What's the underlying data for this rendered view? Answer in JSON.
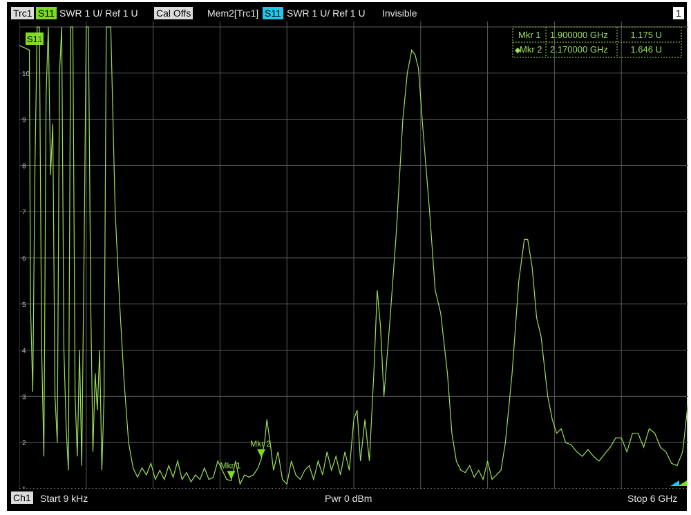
{
  "header": {
    "trace_label": "Trc1",
    "trace_param": "S11",
    "trace_format": "SWR  1 U/  Ref 1 U",
    "cal_status": "Cal Offs",
    "mem_label": "Mem2[Trc1]",
    "mem_param": "S11",
    "mem_format": "SWR  1 U/  Ref 1 U",
    "mem_status": "Invisible",
    "window_number": "1"
  },
  "markers_table": [
    {
      "name": "Mkr 1",
      "freq": "1.900000 GHz",
      "value": "1.175 U",
      "active": false
    },
    {
      "name": "Mkr 2",
      "freq": "2.170000 GHz",
      "value": "1.646 U",
      "active": true
    }
  ],
  "footer": {
    "channel": "Ch1",
    "start": "Start  9 kHz",
    "power": "Pwr  0 dBm",
    "stop": "Stop  6 GHz"
  },
  "colors": {
    "trace": "#9be05a",
    "trace_badge": "#7ddc1f",
    "mem_badge": "#22c8e8",
    "grid": "#5a5a5a",
    "background": "#000000"
  },
  "chart_data": {
    "type": "line",
    "trace_tag": "S11",
    "xlim": [
      9e-06,
      6.0
    ],
    "ylim": [
      1,
      11
    ],
    "yticks": [
      "10",
      "9",
      "8",
      "7",
      "6",
      "5",
      "4",
      "3",
      "2",
      "1"
    ],
    "grid": true,
    "markers": [
      {
        "name": "Mkr 1",
        "label": "Mkr 1",
        "x": 1.9,
        "y": 1.175
      },
      {
        "name": "Mkr 2",
        "label": "Mkr 2",
        "x": 2.17,
        "y": 1.646
      }
    ],
    "series": [
      {
        "points": [
          [
            0.0,
            10.6
          ],
          [
            0.09,
            10.5
          ],
          [
            0.1,
            5.0
          ],
          [
            0.12,
            3.1
          ],
          [
            0.14,
            8.0
          ],
          [
            0.16,
            11.0
          ],
          [
            0.18,
            11.0
          ],
          [
            0.2,
            4.0
          ],
          [
            0.22,
            1.7
          ],
          [
            0.24,
            9.5
          ],
          [
            0.26,
            11.0
          ],
          [
            0.28,
            7.8
          ],
          [
            0.3,
            8.9
          ],
          [
            0.32,
            3.0
          ],
          [
            0.34,
            2.0
          ],
          [
            0.36,
            10.0
          ],
          [
            0.38,
            11.0
          ],
          [
            0.4,
            4.0
          ],
          [
            0.42,
            2.3
          ],
          [
            0.44,
            1.4
          ],
          [
            0.46,
            11.0
          ],
          [
            0.48,
            11.0
          ],
          [
            0.5,
            3.0
          ],
          [
            0.52,
            1.7
          ],
          [
            0.54,
            4.0
          ],
          [
            0.56,
            1.5
          ],
          [
            0.58,
            6.0
          ],
          [
            0.6,
            11.0
          ],
          [
            0.62,
            11.0
          ],
          [
            0.64,
            5.0
          ],
          [
            0.66,
            1.8
          ],
          [
            0.68,
            3.5
          ],
          [
            0.7,
            2.7
          ],
          [
            0.72,
            4.0
          ],
          [
            0.74,
            1.4
          ],
          [
            0.76,
            3.0
          ],
          [
            0.78,
            11.0
          ],
          [
            0.8,
            11.0
          ],
          [
            0.82,
            11.0
          ],
          [
            0.84,
            9.0
          ],
          [
            0.86,
            7.0
          ],
          [
            0.9,
            5.0
          ],
          [
            0.94,
            3.3
          ],
          [
            0.98,
            2.0
          ],
          [
            1.02,
            1.45
          ],
          [
            1.06,
            1.25
          ],
          [
            1.1,
            1.45
          ],
          [
            1.14,
            1.3
          ],
          [
            1.18,
            1.55
          ],
          [
            1.22,
            1.2
          ],
          [
            1.26,
            1.4
          ],
          [
            1.3,
            1.2
          ],
          [
            1.34,
            1.5
          ],
          [
            1.38,
            1.25
          ],
          [
            1.42,
            1.6
          ],
          [
            1.46,
            1.2
          ],
          [
            1.5,
            1.35
          ],
          [
            1.54,
            1.15
          ],
          [
            1.58,
            1.3
          ],
          [
            1.62,
            1.2
          ],
          [
            1.66,
            1.45
          ],
          [
            1.7,
            1.2
          ],
          [
            1.74,
            1.25
          ],
          [
            1.78,
            1.6
          ],
          [
            1.82,
            1.4
          ],
          [
            1.86,
            1.2
          ],
          [
            1.9,
            1.175
          ],
          [
            1.94,
            1.6
          ],
          [
            1.98,
            1.1
          ],
          [
            2.02,
            1.3
          ],
          [
            2.06,
            1.25
          ],
          [
            2.1,
            1.3
          ],
          [
            2.14,
            1.45
          ],
          [
            2.17,
            1.646
          ],
          [
            2.2,
            2.0
          ],
          [
            2.22,
            2.5
          ],
          [
            2.25,
            2.0
          ],
          [
            2.28,
            1.4
          ],
          [
            2.32,
            1.8
          ],
          [
            2.36,
            1.2
          ],
          [
            2.4,
            1.1
          ],
          [
            2.44,
            1.6
          ],
          [
            2.48,
            1.3
          ],
          [
            2.52,
            1.2
          ],
          [
            2.56,
            1.4
          ],
          [
            2.6,
            1.5
          ],
          [
            2.64,
            1.2
          ],
          [
            2.68,
            1.6
          ],
          [
            2.72,
            1.3
          ],
          [
            2.76,
            1.8
          ],
          [
            2.8,
            1.4
          ],
          [
            2.84,
            1.7
          ],
          [
            2.88,
            1.3
          ],
          [
            2.92,
            1.8
          ],
          [
            2.96,
            1.4
          ],
          [
            3.0,
            2.5
          ],
          [
            3.03,
            2.7
          ],
          [
            3.06,
            1.6
          ],
          [
            3.1,
            2.5
          ],
          [
            3.14,
            1.6
          ],
          [
            3.18,
            3.5
          ],
          [
            3.21,
            5.3
          ],
          [
            3.24,
            4.5
          ],
          [
            3.27,
            3.0
          ],
          [
            3.32,
            4.5
          ],
          [
            3.38,
            6.5
          ],
          [
            3.44,
            9.0
          ],
          [
            3.48,
            10.0
          ],
          [
            3.52,
            10.5
          ],
          [
            3.55,
            10.4
          ],
          [
            3.58,
            10.1
          ],
          [
            3.62,
            8.8
          ],
          [
            3.68,
            7.0
          ],
          [
            3.73,
            5.3
          ],
          [
            3.78,
            4.8
          ],
          [
            3.84,
            3.5
          ],
          [
            3.88,
            2.2
          ],
          [
            3.92,
            1.6
          ],
          [
            3.96,
            1.4
          ],
          [
            4.0,
            1.35
          ],
          [
            4.04,
            1.5
          ],
          [
            4.08,
            1.25
          ],
          [
            4.12,
            1.4
          ],
          [
            4.16,
            1.2
          ],
          [
            4.2,
            1.6
          ],
          [
            4.24,
            1.2
          ],
          [
            4.28,
            1.3
          ],
          [
            4.32,
            1.4
          ],
          [
            4.36,
            2.0
          ],
          [
            4.42,
            3.5
          ],
          [
            4.48,
            5.5
          ],
          [
            4.53,
            6.4
          ],
          [
            4.56,
            6.4
          ],
          [
            4.6,
            5.8
          ],
          [
            4.64,
            4.7
          ],
          [
            4.68,
            4.3
          ],
          [
            4.74,
            3.0
          ],
          [
            4.78,
            2.5
          ],
          [
            4.82,
            2.2
          ],
          [
            4.86,
            2.3
          ],
          [
            4.9,
            2.0
          ],
          [
            4.95,
            1.95
          ],
          [
            5.0,
            1.8
          ],
          [
            5.05,
            1.7
          ],
          [
            5.1,
            1.85
          ],
          [
            5.15,
            1.7
          ],
          [
            5.2,
            1.6
          ],
          [
            5.25,
            1.75
          ],
          [
            5.3,
            1.9
          ],
          [
            5.35,
            2.1
          ],
          [
            5.4,
            2.1
          ],
          [
            5.45,
            1.8
          ],
          [
            5.5,
            2.2
          ],
          [
            5.55,
            2.2
          ],
          [
            5.6,
            1.9
          ],
          [
            5.65,
            2.3
          ],
          [
            5.7,
            2.2
          ],
          [
            5.75,
            1.9
          ],
          [
            5.8,
            1.8
          ],
          [
            5.85,
            1.55
          ],
          [
            5.9,
            1.5
          ],
          [
            5.95,
            1.8
          ],
          [
            6.0,
            2.9
          ]
        ]
      }
    ]
  }
}
